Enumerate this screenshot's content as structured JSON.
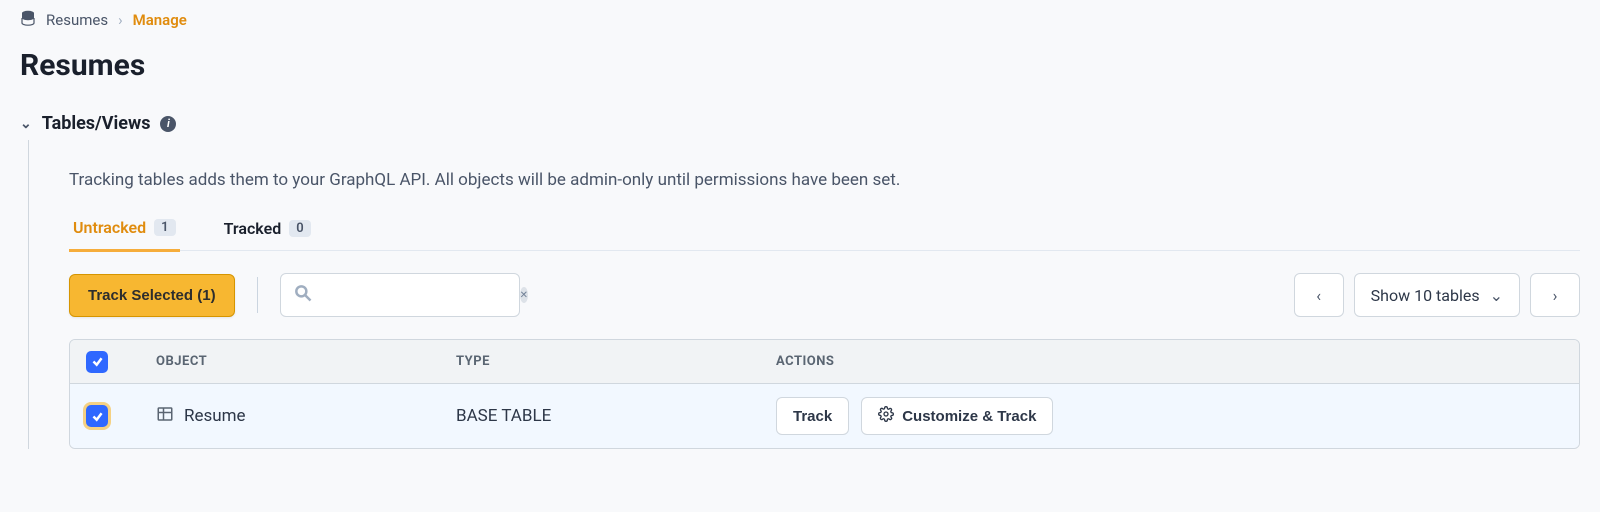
{
  "breadcrumb": {
    "root": "Resumes",
    "current": "Manage"
  },
  "page_title": "Resumes",
  "section": {
    "title": "Tables/Views",
    "description": "Tracking tables adds them to your GraphQL API. All objects will be admin-only until permissions have been set."
  },
  "tabs": {
    "untracked": {
      "label": "Untracked",
      "count": "1"
    },
    "tracked": {
      "label": "Tracked",
      "count": "0"
    }
  },
  "toolbar": {
    "track_selected_label": "Track Selected (1)",
    "search_placeholder": "",
    "page_size_label": "Show 10 tables"
  },
  "table": {
    "headers": {
      "object": "OBJECT",
      "type": "TYPE",
      "actions": "ACTIONS"
    },
    "rows": [
      {
        "name": "Resume",
        "type": "BASE TABLE",
        "track_label": "Track",
        "customize_label": "Customize & Track"
      }
    ]
  }
}
